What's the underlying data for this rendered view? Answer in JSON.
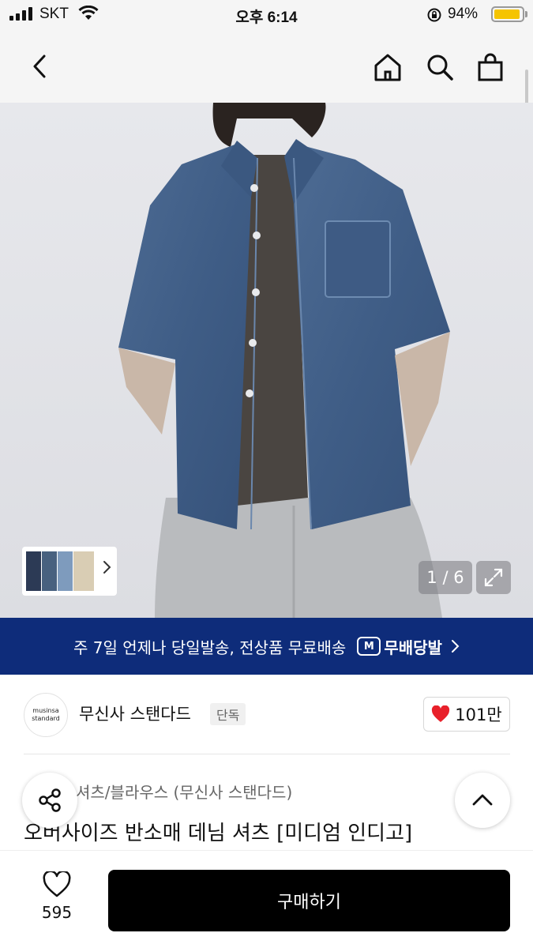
{
  "status_bar": {
    "carrier": "SKT",
    "time": "오후 6:14",
    "battery_percent": "94%",
    "battery_level": 0.94,
    "battery_color": "#f5c400"
  },
  "nav": {
    "back_icon": "chevron-left-icon",
    "home_icon": "home-icon",
    "search_icon": "search-icon",
    "cart_icon": "shopping-bag-icon"
  },
  "gallery": {
    "counter": "1 / 6",
    "expand_icon": "expand-icon",
    "current_index": 1,
    "total": 6
  },
  "banner": {
    "text": "주 7일 언제나 당일발송, 전상품 무료배송",
    "logo_mark": "M",
    "logo_text": "무배당발",
    "background": "#0e2c7a"
  },
  "brand": {
    "logo_line1": "musinsa",
    "logo_line2": "standard",
    "name": "무신사 스탠다드",
    "badge": "단독",
    "likes": "101만",
    "heart_color": "#e8202a"
  },
  "product": {
    "category": "셔츠/블라우스 (무신사 스탠다드)",
    "title": "오버사이즈 반소매 데님 셔츠 [미디엄 인디고]"
  },
  "actions": {
    "wishlist_count": "595",
    "buy_label": "구매하기"
  }
}
